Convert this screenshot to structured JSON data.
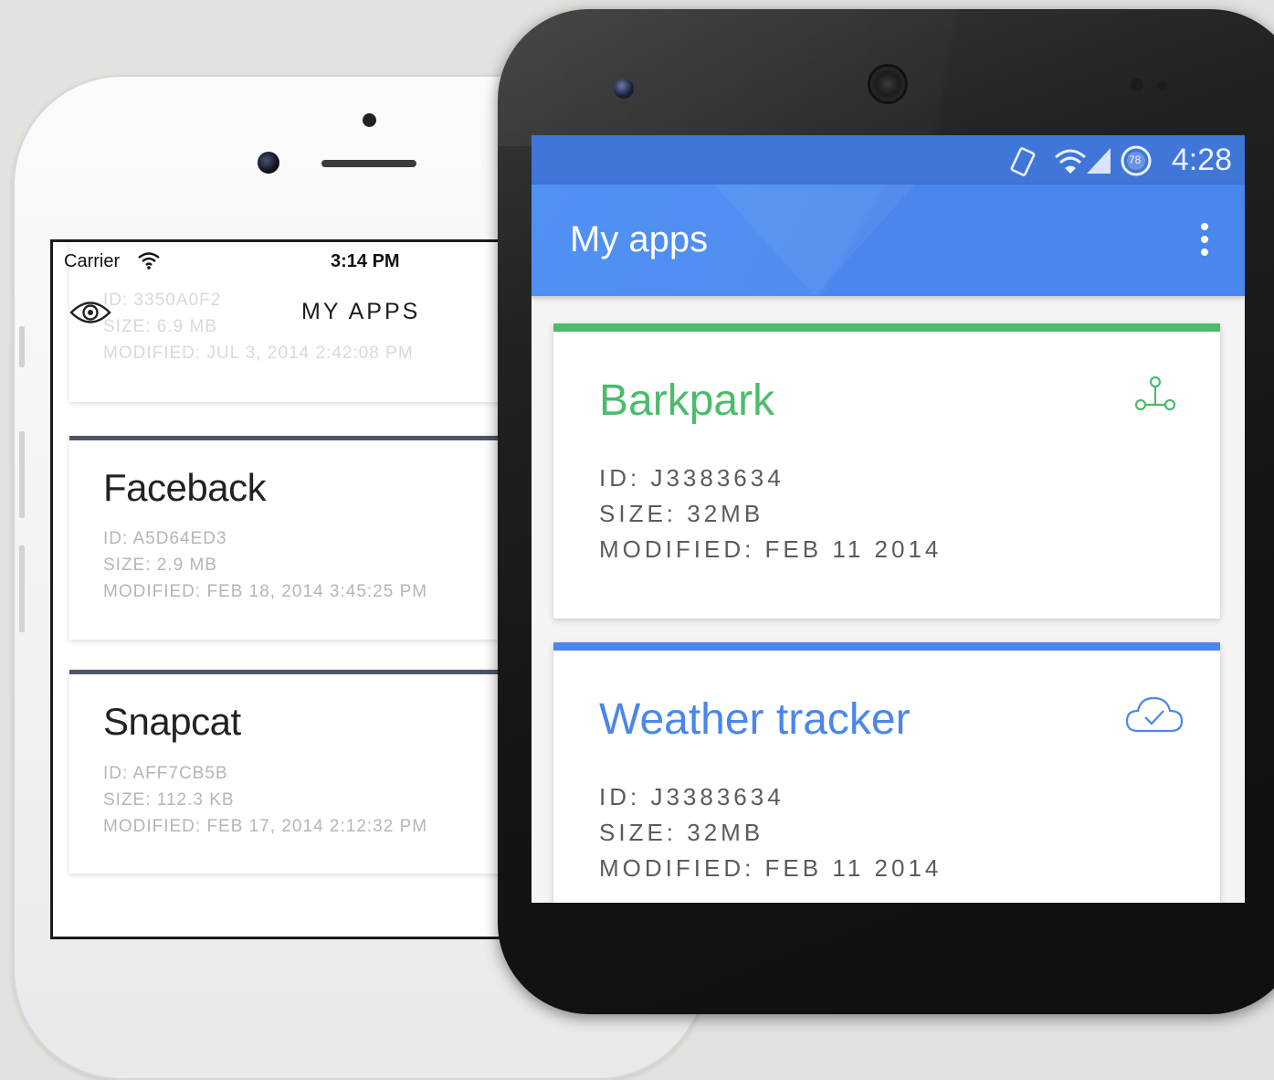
{
  "iphone": {
    "status": {
      "carrier": "Carrier",
      "time": "3:14 PM"
    },
    "nav": {
      "title": "MY APPS",
      "left_icon": "eye-icon"
    },
    "apps": [
      {
        "name": "",
        "id": "ID: 3350A0F2",
        "size": "SIZE: 6.9 MB",
        "modified": "MODIFIED: JUL 3, 2014 2:42:08 PM"
      },
      {
        "name": "Faceback",
        "id": "ID: A5D64ED3",
        "size": "SIZE: 2.9 MB",
        "modified": "MODIFIED: FEB 18, 2014 3:45:25 PM"
      },
      {
        "name": "Snapcat",
        "id": "ID: AFF7CB5B",
        "size": "SIZE: 112.3 KB",
        "modified": "MODIFIED: FEB 17, 2014 2:12:32 PM"
      }
    ]
  },
  "android": {
    "status": {
      "time": "4:28",
      "battery_label": "78"
    },
    "toolbar": {
      "title": "My apps",
      "menu_icon": "overflow-menu-icon"
    },
    "apps": [
      {
        "name": "Barkpark",
        "id": "ID: J3383634",
        "size": "SIZE: 32MB",
        "modified": "MODIFIED: FEB 11 2014",
        "accent": "#4cbb6c",
        "icon": "branch-icon"
      },
      {
        "name": "Weather tracker",
        "id": "ID: J3383634",
        "size": "SIZE: 32MB",
        "modified": "MODIFIED: FEB 11 2014",
        "accent": "#4a86ec",
        "icon": "cloud-check-icon"
      }
    ]
  },
  "colors": {
    "background": "#e4e2df",
    "android_primary": "#4a86ec",
    "android_status": "#3f76d8",
    "iphone_card_accent": "#4a5568"
  }
}
